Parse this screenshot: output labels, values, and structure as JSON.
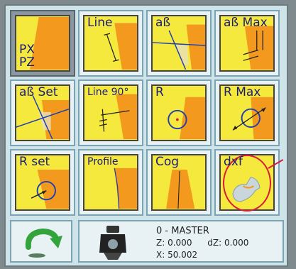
{
  "tiles": [
    {
      "label_line1": "PX",
      "label_line2": "PZ",
      "selected": true
    },
    {
      "label": "Line"
    },
    {
      "label": "aß"
    },
    {
      "label": "aß Max"
    },
    {
      "label": "aß Set"
    },
    {
      "label": "Line 90°"
    },
    {
      "label": "R"
    },
    {
      "label": "R Max"
    },
    {
      "label": "R set"
    },
    {
      "label": "Profile"
    },
    {
      "label": "Cog"
    },
    {
      "label": "dxf"
    }
  ],
  "status": {
    "tool_name": "0 - MASTER",
    "z_label": "Z:",
    "z_value": "0.000",
    "dz_label": "dZ:",
    "dz_value": "0.000",
    "x_label": "X:",
    "x_value": "50.002"
  },
  "colors": {
    "tile_face": "#f6e93e",
    "orange_shape": "#f39a1e",
    "label_text": "#1b1d7a",
    "highlight": "#d81b3a"
  },
  "icons": {
    "return": "return-arrow-icon",
    "tool": "tool-holder-icon"
  }
}
